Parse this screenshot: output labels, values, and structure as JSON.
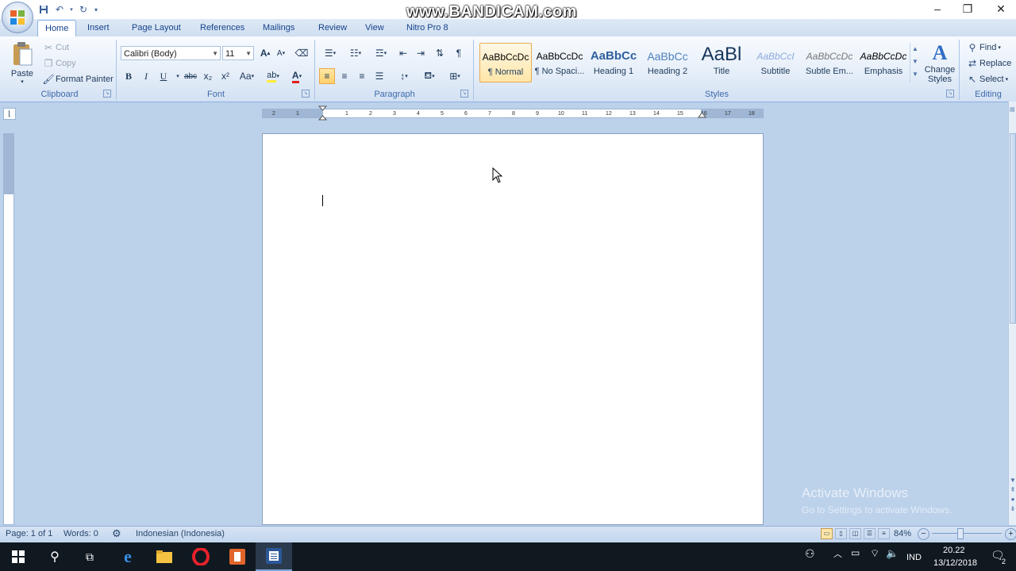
{
  "watermark": "www.BANDICAM.com",
  "window_controls": {
    "minimize": "–",
    "restore": "❐",
    "close": "✕"
  },
  "tabs": [
    "Home",
    "Insert",
    "Page Layout",
    "References",
    "Mailings",
    "Review",
    "View",
    "Nitro Pro 8"
  ],
  "clipboard": {
    "label": "Clipboard",
    "paste": "Paste",
    "cut": "Cut",
    "copy": "Copy",
    "format_painter": "Format Painter"
  },
  "font": {
    "label": "Font",
    "name": "Calibri (Body)",
    "size": "11",
    "grow": "A",
    "shrink": "A",
    "bold": "B",
    "italic": "I",
    "underline": "U",
    "strike": "abc",
    "subscript": "x₂",
    "superscript": "x²",
    "change_case": "Aa",
    "font_color": "A"
  },
  "paragraph": {
    "label": "Paragraph",
    "pilcrow": "¶"
  },
  "styles": {
    "label": "Styles",
    "items": [
      {
        "preview": "AaBbCcDc",
        "name": "¶ Normal"
      },
      {
        "preview": "AaBbCcDc",
        "name": "¶ No Spaci..."
      },
      {
        "preview": "AaBbCc",
        "name": "Heading 1"
      },
      {
        "preview": "AaBbCc",
        "name": "Heading 2"
      },
      {
        "preview": "AaBl",
        "name": "Title"
      },
      {
        "preview": "AaBbCcI",
        "name": "Subtitle"
      },
      {
        "preview": "AaBbCcDc",
        "name": "Subtle Em..."
      },
      {
        "preview": "AaBbCcDc",
        "name": "Emphasis"
      }
    ],
    "change_styles": "Change Styles"
  },
  "editing": {
    "label": "Editing",
    "find": "Find",
    "replace": "Replace",
    "select": "Select"
  },
  "ruler_ticks": [
    "2",
    "1",
    "1",
    "2",
    "3",
    "4",
    "5",
    "6",
    "7",
    "8",
    "9",
    "10",
    "11",
    "12",
    "13",
    "14",
    "15",
    "16",
    "17",
    "18"
  ],
  "status": {
    "page": "Page: 1 of 1",
    "words": "Words: 0",
    "language": "Indonesian (Indonesia)",
    "zoom": "84%"
  },
  "activate": {
    "title": "Activate Windows",
    "subtitle": "Go to Settings to activate Windows."
  },
  "tray": {
    "lang": "IND",
    "time": "20.22",
    "date": "13/12/2018",
    "notifications": "2"
  },
  "colors": {
    "accent": "#15428b",
    "ribbon_border": "#8db2e3",
    "taskbar": "#101820"
  }
}
